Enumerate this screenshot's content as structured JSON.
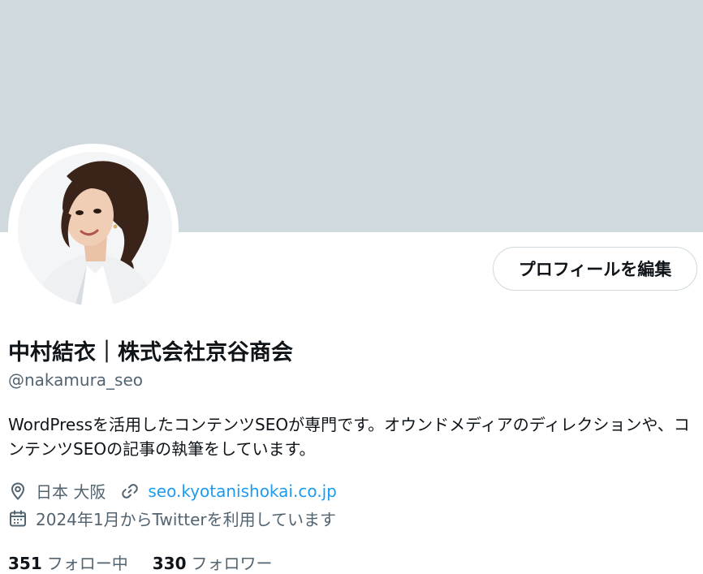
{
  "colors": {
    "banner": "#cfd9de",
    "text_primary": "#0f1419",
    "text_secondary": "#536471",
    "link": "#1d9bf0"
  },
  "profile": {
    "edit_button_label": "プロフィールを編集",
    "name": "中村結衣｜株式会社京谷商会",
    "handle": "@nakamura_seo",
    "bio": "WordPressを活用したコンテンツSEOが専門です。オウンドメディアのディレクションや、コンテンツSEOの記事の執筆をしています。",
    "location": "日本 大阪",
    "website": "seo.kyotanishokai.co.jp",
    "joined": "2024年1月からTwitterを利用しています",
    "following_count": "351",
    "following_label": "フォロー中",
    "followers_count": "330",
    "followers_label": "フォロワー"
  },
  "icons": {
    "location": "location-pin-icon",
    "link": "link-icon",
    "calendar": "calendar-icon"
  }
}
